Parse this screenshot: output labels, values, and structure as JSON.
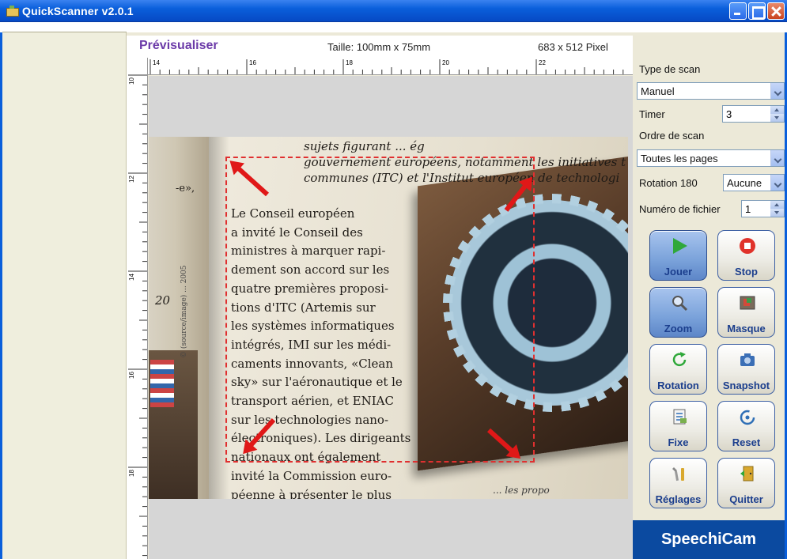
{
  "window": {
    "title": "QuickScanner v2.0.1"
  },
  "preview": {
    "title": "Prévisualiser",
    "size_label": "Taille: 100mm x 75mm",
    "pixel_label": "683 x 512 Pixel",
    "ruler_top_labels": [
      "14",
      "16",
      "18",
      "20",
      "22"
    ],
    "ruler_left_labels": [
      "10",
      "12",
      "14",
      "16",
      "18"
    ]
  },
  "photo_text": {
    "top_lines": [
      "sujets figurant ... ég",
      "gouvernement européens, notamment les initiatives t",
      "communes (ITC) et l'Institut européen de technologi"
    ],
    "column_lines": [
      "Le Conseil européen",
      "a invité le Conseil des",
      "ministres à marquer rapi-",
      "dement son accord sur les",
      "quatre premières proposi-",
      "tions d'ITC (Artemis sur",
      "les systèmes informatiques",
      "intégrés, IMI sur les médi-",
      "caments innovants, «Clean",
      "sky» sur l'aéronautique et le",
      "transport aérien, et ENIAC",
      "sur les technologies nano-",
      "électroniques). Les dirigeants",
      "nationaux ont également",
      "invité la Commission euro-",
      "péenne à présenter le plus"
    ],
    "margin_1": "-e»,",
    "margin_2": "20",
    "bottom_fragment": "... les propo",
    "vertical_caption": "© (source/image) ... 2005"
  },
  "controls": {
    "scan_type_label": "Type de scan",
    "scan_type_value": "Manuel",
    "timer_label": "Timer",
    "timer_value": "3",
    "scan_order_label": "Ordre de scan",
    "scan_order_value": "Toutes les pages",
    "rotation_label": "Rotation 180",
    "rotation_value": "Aucune",
    "file_number_label": "Numéro de fichier",
    "file_number_value": "1"
  },
  "buttons": {
    "play": "Jouer",
    "stop": "Stop",
    "zoom": "Zoom",
    "mask": "Masque",
    "rotation": "Rotation",
    "snapshot": "Snapshot",
    "fixe": "Fixe",
    "reset": "Reset",
    "settings": "Réglages",
    "quit": "Quitter"
  },
  "brand": "SpeechiCam",
  "colors": {
    "titlebar": "#0a5fdb",
    "preview_title": "#6b3aa8",
    "selection_box": "#e03030",
    "arrows": "#e01818",
    "button_label": "#1b3e8d",
    "brand_bg": "#0b4aa0"
  }
}
